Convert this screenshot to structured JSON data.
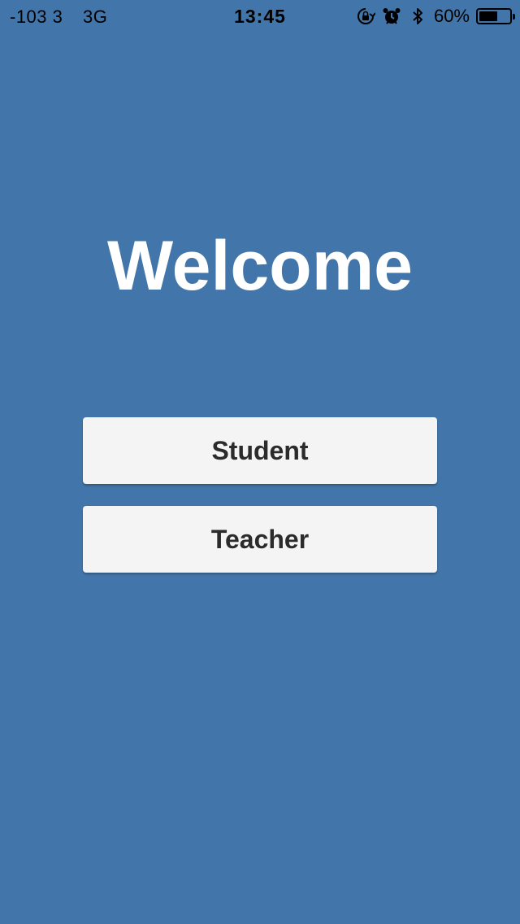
{
  "status_bar": {
    "signal_strength": "-103",
    "signal_bars": "3",
    "network": "3G",
    "time": "13:45",
    "icons": [
      "orientation-lock-icon",
      "alarm-icon",
      "bluetooth-icon"
    ],
    "battery_percent_label": "60%",
    "battery_level": 0.6
  },
  "welcome": {
    "title": "Welcome"
  },
  "roles": {
    "student_label": "Student",
    "teacher_label": "Teacher"
  },
  "colors": {
    "background": "#4275a9",
    "button_background": "#f4f4f4",
    "button_text": "#2b2b2b",
    "title_text": "#ffffff"
  }
}
